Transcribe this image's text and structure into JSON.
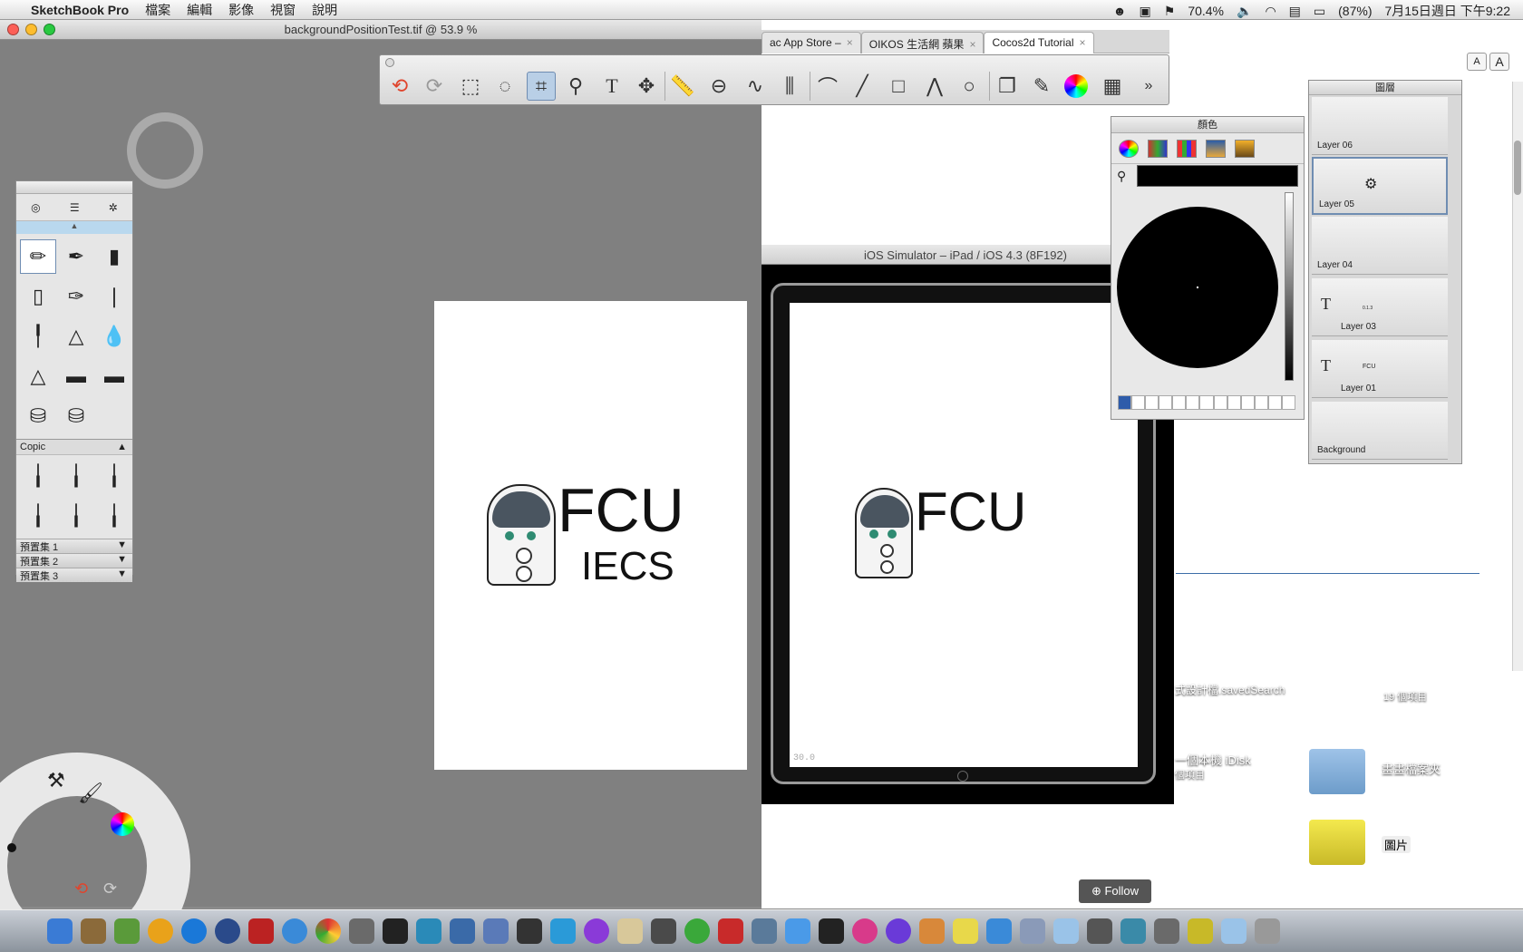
{
  "menubar": {
    "app": "SketchBook Pro",
    "menus": [
      "檔案",
      "編輯",
      "影像",
      "視窗",
      "說明"
    ],
    "battery": "70.4%",
    "battery_pct": "(87%)",
    "datetime": "7月15日週日 下午9:22"
  },
  "sketchbook": {
    "doc_title": "backgroundPositionTest.tif @ 53.9 %"
  },
  "canvas_logo": {
    "line1": "FCU",
    "line2": "IECS"
  },
  "browser": {
    "tabs": [
      {
        "label": "ac App Store –",
        "close": "×"
      },
      {
        "label": "OIKOS 生活網 蘋果",
        "close": "×"
      },
      {
        "label": "Cocos2d Tutorial",
        "close": "×"
      }
    ],
    "font_small": "A",
    "font_large": "A",
    "follow": "Follow"
  },
  "simulator": {
    "title": "iOS Simulator – iPad / iOS 4.3 (8F192)",
    "logo": "FCU",
    "fps": "30.0"
  },
  "brush_palette": {
    "section": "Copic",
    "presets": [
      "預置集 1",
      "預置集 2",
      "預置集 3"
    ]
  },
  "color_panel": {
    "title": "顏色"
  },
  "layers_panel": {
    "title": "圖層",
    "layers": [
      "Layer 06",
      "Layer 05",
      "Layer 04",
      "Layer 03",
      "Layer 01",
      "Background"
    ],
    "layer03_thumb": "0.1.3",
    "layer01_thumb": "FCU"
  },
  "desktop": {
    "saved_search": "式設計檔.savedSearch",
    "items_count": "19 個項目",
    "idisk": "一個本機 iDisk",
    "idisk_sub": "個項目",
    "folder1": "畫畫檔案夾",
    "folder2": "圖片"
  }
}
